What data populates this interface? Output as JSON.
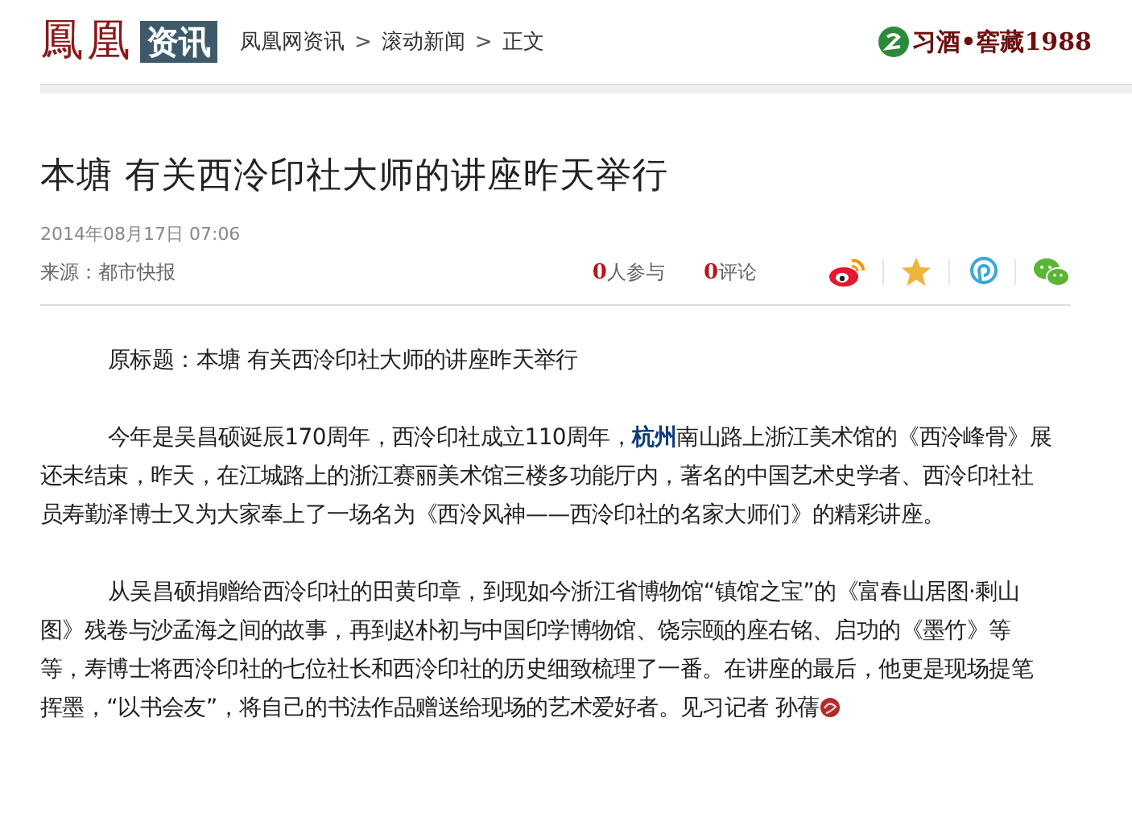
{
  "header": {
    "logo_main": "鳳凰",
    "logo_tag": "资讯",
    "breadcrumbs": [
      "凤凰网资讯",
      "滚动新闻",
      "正文"
    ],
    "separator": ">",
    "ad_text": "习酒•窖藏1988"
  },
  "article": {
    "title": "本塘  有关西泠印社大师的讲座昨天举行",
    "datetime": "2014年08月17日  07:06",
    "source": "来源：都市快报",
    "stats": [
      {
        "count": "0",
        "label": "人参与"
      },
      {
        "count": "0",
        "label": "评论"
      }
    ],
    "share": [
      {
        "kind": "weibo"
      },
      {
        "kind": "qzone"
      },
      {
        "kind": "tencent"
      },
      {
        "kind": "wechat"
      }
    ],
    "paragraphs": [
      {
        "segments": [
          {
            "kind": "text",
            "text": "原标题：本塘  有关西泠印社大师的讲座昨天举行"
          }
        ]
      },
      {
        "segments": [
          {
            "kind": "text",
            "text": "今年是吴昌硕诞辰170周年，西泠印社成立110周年，"
          },
          {
            "kind": "link",
            "text": "杭州"
          },
          {
            "kind": "text",
            "text": "南山路上浙江美术馆的《西泠峰骨》展还未结束，昨天，在江城路上的浙江赛丽美术馆三楼多功能厅内，著名的中国艺术史学者、西泠印社社员寿勤泽博士又为大家奉上了一场名为《西泠风神——西泠印社的名家大师们》的精彩讲座。"
          }
        ]
      },
      {
        "segments": [
          {
            "kind": "text",
            "text": "从吴昌硕捐赠给西泠印社的田黄印章，到现如今浙江省博物馆“镇馆之宝”的《富春山居图·剩山图》残卷与沙孟海之间的故事，再到赵朴初与中国印学博物馆、饶宗颐的座右铭、启功的《墨竹》等等，寿博士将西泠印社的七位社长和西泠印社的历史细致梳理了一番。在讲座的最后，他更是现场提笔挥墨，“以书会友”，将自己的书法作品赠送给现场的艺术爱好者。见习记者  孙蒨"
          }
        ],
        "end_mark": true
      }
    ]
  }
}
